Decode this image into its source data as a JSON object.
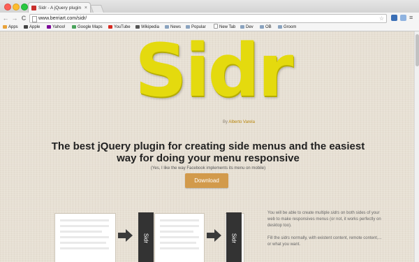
{
  "browser": {
    "tab_title": "Sidr - A jQuery plugin for c",
    "tab_close": "×",
    "url": "www.berriart.com/sidr/",
    "back": "←",
    "forward": "→",
    "reload": "C",
    "star": "☆",
    "menu": "≡"
  },
  "bookmarks": [
    {
      "label": "Apps",
      "color": "#e8a23a"
    },
    {
      "label": "Apple",
      "color": "#444444"
    },
    {
      "label": "Yahoo!",
      "color": "#7b0099"
    },
    {
      "label": "Google Maps",
      "color": "#4aa35b"
    },
    {
      "label": "YouTube",
      "color": "#d82a20"
    },
    {
      "label": "Wikipedia",
      "color": "#555555"
    },
    {
      "label": "News",
      "color": "#8aa3bf"
    },
    {
      "label": "Popular",
      "color": "#8aa3bf"
    },
    {
      "label": "New Tab",
      "color": "#ffffff"
    },
    {
      "label": "Dev",
      "color": "#8aa3bf"
    },
    {
      "label": "OB",
      "color": "#8aa3bf"
    },
    {
      "label": "Groom",
      "color": "#8aa3bf"
    }
  ],
  "page": {
    "logo": "Sidr",
    "byline_prefix": "By",
    "byline_author": "Alberto Varela",
    "headline": "The best jQuery plugin for creating side menus and the easiest way for doing your menu responsive",
    "subline": "(Yes, I like the way Facebook implements its menu on mobile)",
    "download_label": "Download",
    "sidr_label_1": "Sidr",
    "sidr_label_2": "Sidr",
    "desc_p1_a": "You will be able to create multiple ",
    "desc_p1_em": "sidrs",
    "desc_p1_b": " on both sides of your web to make responsives menus (or not, it works perfectly on desktop too).",
    "desc_p2_a": "Fill the ",
    "desc_p2_em": "sidrs",
    "desc_p2_b": " normally, with existent content, remote content,... or what you want."
  },
  "colors": {
    "logo_yellow": "#e4da0e",
    "download_button": "#d29a4b",
    "page_background": "#e7e0d4"
  }
}
